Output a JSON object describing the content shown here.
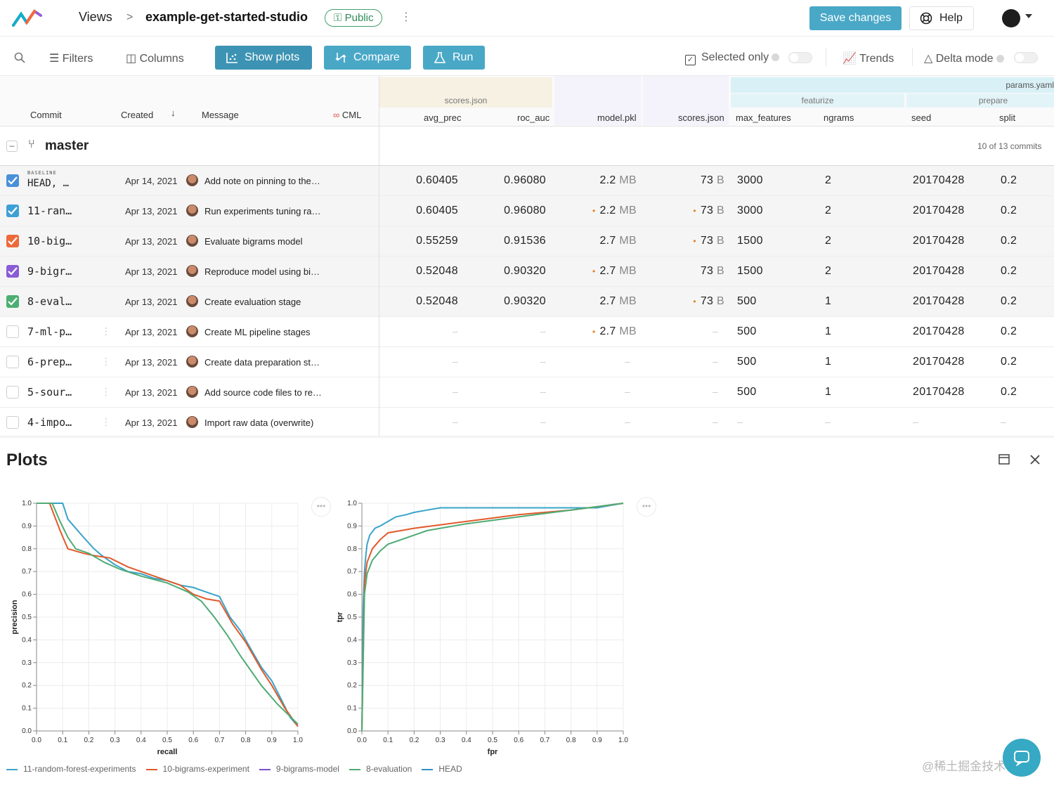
{
  "header": {
    "views_label": "Views",
    "separator": ">",
    "project_name": "example-get-started-studio",
    "public_badge": "Public",
    "save_label": "Save changes",
    "help_label": "Help"
  },
  "toolbar": {
    "filters": "Filters",
    "columns": "Columns",
    "show_plots": "Show plots",
    "compare": "Compare",
    "run": "Run",
    "selected_only": "Selected only",
    "trends": "Trends",
    "delta_mode": "Delta mode"
  },
  "table_header": {
    "commit": "Commit",
    "created": "Created",
    "message": "Message",
    "cml": "CML",
    "group_scores": "scores.json",
    "avg_prec": "avg_prec",
    "roc_auc": "roc_auc",
    "model_pkl": "model.pkl",
    "scores_json": "scores.json",
    "group_params": "params.yaml",
    "group_featurize": "featurize",
    "group_prepare": "prepare",
    "max_features": "max_features",
    "ngrams": "ngrams",
    "seed": "seed",
    "split": "split"
  },
  "branch": {
    "name": "master",
    "count": "10 of 13 commits"
  },
  "rows": [
    {
      "badge": "BASELINE",
      "commit": "HEAD, …",
      "date": "Apr 14, 2021",
      "message": "Add note on pinning to the…",
      "avg_prec": "0.60405",
      "roc_auc": "0.96080",
      "model_val": "2.2",
      "model_unit": "MB",
      "model_dot": "",
      "scores_val": "73",
      "scores_unit": "B",
      "scores_dot": "",
      "max_features": "3000",
      "ngrams": "2",
      "seed": "20170428",
      "split": "0.2",
      "color": "#4a90d9"
    },
    {
      "badge": "",
      "commit": "11-ran…",
      "date": "Apr 13, 2021",
      "message": "Run experiments tuning ra…",
      "avg_prec": "0.60405",
      "roc_auc": "0.96080",
      "model_val": "2.2",
      "model_unit": "MB",
      "model_dot": "•",
      "scores_val": "73",
      "scores_unit": "B",
      "scores_dot": "•",
      "max_features": "3000",
      "ngrams": "2",
      "seed": "20170428",
      "split": "0.2",
      "color": "#3fa0d6"
    },
    {
      "badge": "",
      "commit": "10-big…",
      "date": "Apr 13, 2021",
      "message": "Evaluate bigrams model",
      "avg_prec": "0.55259",
      "roc_auc": "0.91536",
      "model_val": "2.7",
      "model_unit": "MB",
      "model_dot": "",
      "scores_val": "73",
      "scores_unit": "B",
      "scores_dot": "•",
      "max_features": "1500",
      "ngrams": "2",
      "seed": "20170428",
      "split": "0.2",
      "color": "#ee6a3a"
    },
    {
      "badge": "",
      "commit": "9-bigr…",
      "date": "Apr 13, 2021",
      "message": "Reproduce model using bi…",
      "avg_prec": "0.52048",
      "roc_auc": "0.90320",
      "model_val": "2.7",
      "model_unit": "MB",
      "model_dot": "•",
      "scores_val": "73",
      "scores_unit": "B",
      "scores_dot": "",
      "max_features": "1500",
      "ngrams": "2",
      "seed": "20170428",
      "split": "0.2",
      "color": "#8a5cd6"
    },
    {
      "badge": "",
      "commit": "8-eval…",
      "date": "Apr 13, 2021",
      "message": "Create evaluation stage",
      "avg_prec": "0.52048",
      "roc_auc": "0.90320",
      "model_val": "2.7",
      "model_unit": "MB",
      "model_dot": "",
      "scores_val": "73",
      "scores_unit": "B",
      "scores_dot": "•",
      "max_features": "500",
      "ngrams": "1",
      "seed": "20170428",
      "split": "0.2",
      "color": "#4caf72"
    },
    {
      "badge": "",
      "commit": "7-ml-p…",
      "date": "Apr 13, 2021",
      "message": "Create ML pipeline stages",
      "avg_prec": "",
      "roc_auc": "",
      "model_val": "2.7",
      "model_unit": "MB",
      "model_dot": "•",
      "scores_val": "",
      "scores_unit": "",
      "scores_dot": "",
      "max_features": "500",
      "ngrams": "1",
      "seed": "20170428",
      "split": "0.2",
      "color": ""
    },
    {
      "badge": "",
      "commit": "6-prep…",
      "date": "Apr 13, 2021",
      "message": "Create data preparation st…",
      "avg_prec": "",
      "roc_auc": "",
      "model_val": "",
      "model_unit": "",
      "model_dot": "",
      "scores_val": "",
      "scores_unit": "",
      "scores_dot": "",
      "max_features": "500",
      "ngrams": "1",
      "seed": "20170428",
      "split": "0.2",
      "color": ""
    },
    {
      "badge": "",
      "commit": "5-sour…",
      "date": "Apr 13, 2021",
      "message": "Add source code files to re…",
      "avg_prec": "",
      "roc_auc": "",
      "model_val": "",
      "model_unit": "",
      "model_dot": "",
      "scores_val": "",
      "scores_unit": "",
      "scores_dot": "",
      "max_features": "500",
      "ngrams": "1",
      "seed": "20170428",
      "split": "0.2",
      "color": ""
    },
    {
      "badge": "",
      "commit": "4-impo…",
      "date": "Apr 13, 2021",
      "message": "Import raw data (overwrite)",
      "avg_prec": "",
      "roc_auc": "",
      "model_val": "",
      "model_unit": "",
      "model_dot": "",
      "scores_val": "",
      "scores_unit": "",
      "scores_dot": "",
      "max_features": "",
      "ngrams": "",
      "seed": "",
      "split": "",
      "color": ""
    }
  ],
  "dash": "–",
  "plots": {
    "title": "Plots",
    "watermark": "@稀土掘金技术社区"
  },
  "chart_data": [
    {
      "type": "line",
      "xlabel": "recall",
      "ylabel": "precision",
      "xlim": [
        0,
        1
      ],
      "ylim": [
        0,
        1
      ],
      "xticks": [
        "0.0",
        "0.1",
        "0.2",
        "0.3",
        "0.4",
        "0.5",
        "0.6",
        "0.7",
        "0.8",
        "0.9",
        "1.0"
      ],
      "yticks": [
        "0.0",
        "0.1",
        "0.2",
        "0.3",
        "0.4",
        "0.5",
        "0.6",
        "0.7",
        "0.8",
        "0.9",
        "1.0"
      ],
      "grid": true,
      "series": [
        {
          "name": "11-random-forest-experiments",
          "color": "#3aa3c9",
          "x": [
            0.0,
            0.1,
            0.12,
            0.18,
            0.22,
            0.25,
            0.3,
            0.35,
            0.4,
            0.45,
            0.5,
            0.55,
            0.6,
            0.65,
            0.7,
            0.74,
            0.78,
            0.82,
            0.86,
            0.9,
            0.94,
            0.97,
            1.0
          ],
          "y": [
            1.0,
            1.0,
            0.93,
            0.85,
            0.8,
            0.77,
            0.73,
            0.7,
            0.69,
            0.67,
            0.66,
            0.64,
            0.63,
            0.61,
            0.59,
            0.5,
            0.44,
            0.36,
            0.28,
            0.22,
            0.13,
            0.06,
            0.02
          ]
        },
        {
          "name": "10-bigrams-experiment",
          "color": "#e05a2b",
          "x": [
            0.0,
            0.05,
            0.09,
            0.12,
            0.18,
            0.22,
            0.28,
            0.35,
            0.4,
            0.45,
            0.55,
            0.6,
            0.65,
            0.7,
            0.75,
            0.8,
            0.86,
            0.9,
            0.95,
            1.0
          ],
          "y": [
            1.0,
            1.0,
            0.88,
            0.8,
            0.78,
            0.77,
            0.76,
            0.72,
            0.7,
            0.68,
            0.64,
            0.6,
            0.58,
            0.57,
            0.47,
            0.39,
            0.27,
            0.2,
            0.1,
            0.02
          ]
        },
        {
          "name": "9-bigrams-model",
          "color": "#7b4fcf",
          "x": [],
          "y": []
        },
        {
          "name": "8-evaluation",
          "color": "#4fab74",
          "x": [
            0.0,
            0.06,
            0.09,
            0.12,
            0.15,
            0.2,
            0.26,
            0.32,
            0.4,
            0.5,
            0.58,
            0.63,
            0.68,
            0.73,
            0.78,
            0.86,
            0.92,
            1.0
          ],
          "y": [
            1.0,
            1.0,
            0.92,
            0.85,
            0.8,
            0.78,
            0.74,
            0.71,
            0.68,
            0.65,
            0.61,
            0.57,
            0.5,
            0.42,
            0.33,
            0.2,
            0.12,
            0.03
          ]
        },
        {
          "name": "HEAD",
          "color": "#2f8fc2",
          "x": [],
          "y": []
        }
      ]
    },
    {
      "type": "line",
      "xlabel": "fpr",
      "ylabel": "tpr",
      "xlim": [
        0,
        1
      ],
      "ylim": [
        0,
        1
      ],
      "xticks": [
        "0.0",
        "0.1",
        "0.2",
        "0.3",
        "0.4",
        "0.5",
        "0.6",
        "0.7",
        "0.8",
        "0.9",
        "1.0"
      ],
      "yticks": [
        "0.0",
        "0.1",
        "0.2",
        "0.3",
        "0.4",
        "0.5",
        "0.6",
        "0.7",
        "0.8",
        "0.9",
        "1.0"
      ],
      "grid": true,
      "series": [
        {
          "name": "11-random-forest-experiments",
          "color": "#3aa3c9",
          "x": [
            0.0,
            0.005,
            0.01,
            0.015,
            0.02,
            0.03,
            0.05,
            0.07,
            0.1,
            0.13,
            0.17,
            0.2,
            0.25,
            0.3,
            0.5,
            0.7,
            0.9,
            0.95,
            1.0
          ],
          "y": [
            0.0,
            0.55,
            0.7,
            0.77,
            0.82,
            0.86,
            0.89,
            0.9,
            0.92,
            0.94,
            0.95,
            0.96,
            0.97,
            0.98,
            0.98,
            0.98,
            0.98,
            0.99,
            1.0
          ]
        },
        {
          "name": "10-bigrams-experiment",
          "color": "#e05a2b",
          "x": [
            0.0,
            0.01,
            0.02,
            0.04,
            0.07,
            0.1,
            0.2,
            0.4,
            0.6,
            0.8,
            1.0
          ],
          "y": [
            0.0,
            0.65,
            0.74,
            0.8,
            0.84,
            0.87,
            0.89,
            0.92,
            0.95,
            0.97,
            1.0
          ]
        },
        {
          "name": "9-bigrams-model",
          "color": "#7b4fcf",
          "x": [],
          "y": []
        },
        {
          "name": "8-evaluation",
          "color": "#4fab74",
          "x": [
            0.0,
            0.01,
            0.02,
            0.04,
            0.07,
            0.1,
            0.25,
            0.4,
            0.6,
            0.8,
            1.0
          ],
          "y": [
            0.0,
            0.6,
            0.69,
            0.75,
            0.79,
            0.82,
            0.88,
            0.91,
            0.94,
            0.97,
            1.0
          ]
        },
        {
          "name": "HEAD",
          "color": "#2f8fc2",
          "x": [],
          "y": []
        }
      ]
    }
  ],
  "legend": [
    {
      "label": "11-random-forest-experiments",
      "color": "#3aa3c9"
    },
    {
      "label": "10-bigrams-experiment",
      "color": "#e05a2b"
    },
    {
      "label": "9-bigrams-model",
      "color": "#7b4fcf"
    },
    {
      "label": "8-evaluation",
      "color": "#4fab74"
    },
    {
      "label": "HEAD",
      "color": "#2f8fc2"
    }
  ]
}
